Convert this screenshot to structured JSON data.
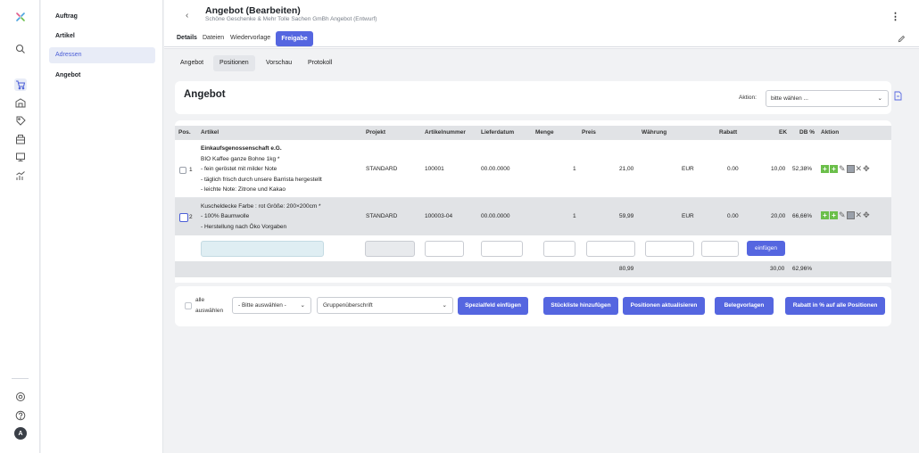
{
  "nav": {
    "avatar_letter": "A"
  },
  "sidebar": {
    "items": [
      {
        "label": "Auftrag"
      },
      {
        "label": "Artikel"
      },
      {
        "label": "Adressen"
      },
      {
        "label": "Angebot"
      }
    ]
  },
  "header": {
    "title": "Angebot (Bearbeiten)",
    "subtitle": "Schöne Geschenke & Mehr Tolle Sachen GmBh Angebot (Entwurf)",
    "tabs": [
      {
        "label": "Details"
      },
      {
        "label": "Dateien"
      },
      {
        "label": "Wiedervorlage"
      }
    ],
    "freigabe_label": "Freigabe"
  },
  "subtabs": [
    {
      "label": "Angebot"
    },
    {
      "label": "Positionen"
    },
    {
      "label": "Vorschau"
    },
    {
      "label": "Protokoll"
    }
  ],
  "card": {
    "title": "Angebot",
    "aktion_label": "Aktion:",
    "aktion_value": "bitte wählen ..."
  },
  "table": {
    "columns": [
      "Pos.",
      "Artikel",
      "Projekt",
      "Artikelnummer",
      "Lieferdatum",
      "Menge",
      "Preis",
      "Währung",
      "Rabatt",
      "EK",
      "DB %",
      "Aktion"
    ],
    "rows": [
      {
        "pos": "1",
        "article_lines": [
          "Einkaufsgenossenschaft e.G.",
          "BIO Kaffee ganze Bohne 1kg *",
          "- fein geröstet mit milder Note",
          "- täglich frisch durch unsere Barrista hergestellt",
          "- leichte Note: Zitrone und Kakao"
        ],
        "projekt": "STANDARD",
        "artikelnummer": "100001",
        "lieferdatum": "00.00.0000",
        "menge": "1",
        "preis": "21,00",
        "waehrung": "EUR",
        "rabatt": "0.00",
        "ek": "10,00",
        "db": "52,38%"
      },
      {
        "pos": "2",
        "article_lines": [
          "Kuscheldecke Farbe : rot Größe: 200×200cm *",
          "- 100% Baumwolle",
          "- Herstellung nach Öko Vorgaben"
        ],
        "projekt": "STANDARD",
        "artikelnummer": "100003-04",
        "lieferdatum": "00.00.0000",
        "menge": "1",
        "preis": "59,99",
        "waehrung": "EUR",
        "rabatt": "0.00",
        "ek": "20,00",
        "db": "66,66%"
      }
    ],
    "insert_button": "einfügen",
    "totals": {
      "preis": "80,99",
      "ek": "30,00",
      "db": "62,96%"
    }
  },
  "footer": {
    "select_all_line1": "alle",
    "select_all_line2": "auswählen",
    "bitte_select": "- Bitte auswählen -",
    "gruppe_select": "Gruppenüberschrift",
    "buttons": [
      {
        "label": "Spezialfeld einfügen"
      },
      {
        "label": "Stückliste hinzufügen"
      },
      {
        "label": "Positionen aktualisieren"
      },
      {
        "label": "Belegvorlagen"
      },
      {
        "label": "Rabatt in % auf alle Positionen"
      }
    ]
  },
  "colors": {
    "accent": "#5566e0",
    "action_green": "#6bbf4a",
    "active_nav": "#4b5ed7"
  }
}
